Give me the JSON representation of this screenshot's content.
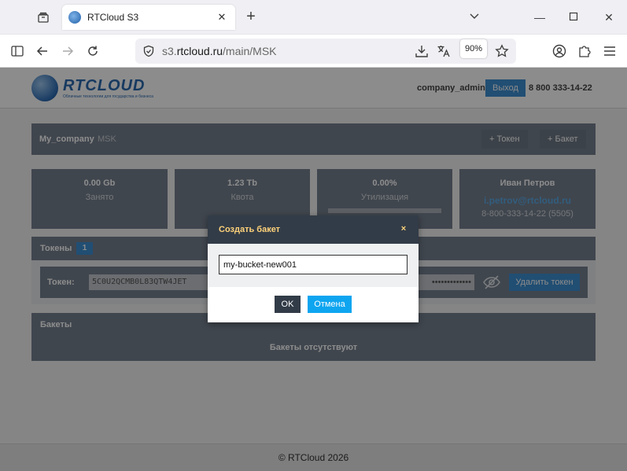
{
  "browser": {
    "tab_title": "RTCloud S3",
    "url_prefix": "s3.",
    "url_domain": "rtcloud.ru",
    "url_path": "/main/MSK",
    "zoom": "90%"
  },
  "header": {
    "logo_name": "RTCLOUD",
    "logo_sub": "Облачные технологии для государства и бизнеса",
    "user": "company_admin",
    "exit_label": "Выход",
    "phone": "8 800 333-14-22"
  },
  "crumb": {
    "company": "My_company",
    "region": "MSK",
    "token_btn": "+  Токен",
    "bucket_btn": "+  Бакет"
  },
  "stats": [
    {
      "value": "0.00 Gb",
      "label": "Занято"
    },
    {
      "value": "1.23 Tb",
      "label": "Квота"
    },
    {
      "value": "0.00%",
      "label": "Утилизация"
    }
  ],
  "user_card": {
    "name": "Иван Петров",
    "email": "i.petrov@rtcloud.ru",
    "phone": "8-800-333-14-22 (5505)"
  },
  "tokens": {
    "title": "Токены",
    "count": "1",
    "token_label": "Токен:",
    "token_value": "5C0U2QCMB0L83QTW4JET",
    "secret_masked": "•••••••••••••",
    "delete_label": "Удалить токен"
  },
  "buckets": {
    "title": "Бакеты",
    "empty": "Бакеты отсутствуют"
  },
  "footer": {
    "copyright": "© RTCloud 2026"
  },
  "modal": {
    "title": "Создать бакет",
    "close": "×",
    "input_value": "my-bucket-new001",
    "ok_label": "OK",
    "cancel_label": "Отмена"
  },
  "colors": {
    "accent": "#3d8fd1",
    "panel": "#76808e",
    "modal_header": "#323c48",
    "modal_title": "#ffd27a",
    "cancel": "#0ea5f0"
  }
}
